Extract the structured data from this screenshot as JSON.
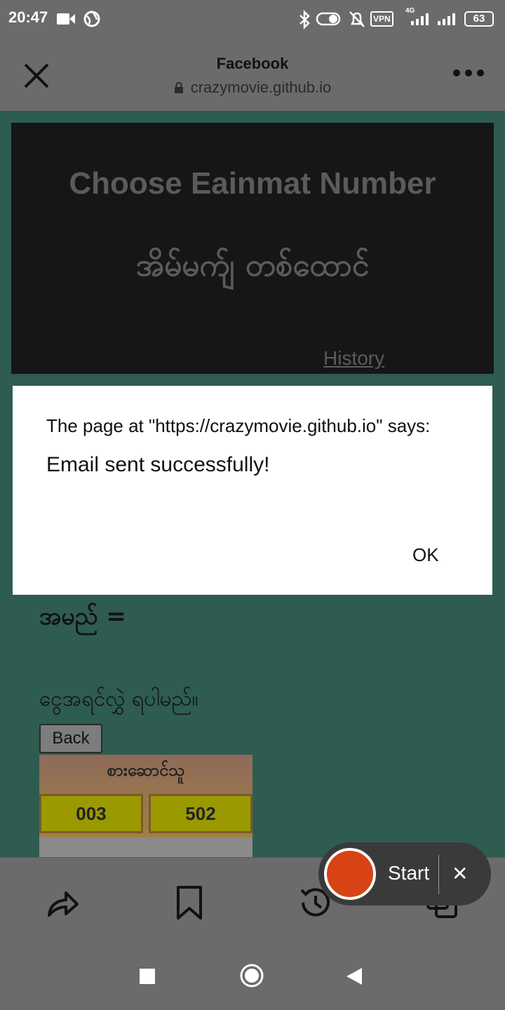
{
  "status_bar": {
    "time": "20:47",
    "vpn": "VPN",
    "network": "4G",
    "battery": "63",
    "icons": [
      "video-icon",
      "globe-icon",
      "bluetooth-icon",
      "toggle-icon",
      "bell-off-icon",
      "vpn-icon",
      "signal-icon",
      "signal-icon",
      "battery-icon"
    ]
  },
  "header": {
    "title": "Facebook",
    "url": "crazymovie.github.io",
    "icons": [
      "close-icon",
      "lock-icon",
      "more-icon"
    ]
  },
  "page": {
    "banner_title": "Choose Eainmat Number",
    "banner_subtitle": "အိမ်မက်ျ တစ်ထောင်",
    "history_link": "History",
    "name_label": "အမည် =",
    "money_label": "ငွေအရင်လွှဲ ရပါမည်။",
    "back_button": "Back",
    "table": {
      "header": "စားဆောင်သူ",
      "cells": [
        "003",
        "502"
      ]
    }
  },
  "dialog": {
    "header": "The page at \"https://crazymovie.github.io\" says:",
    "message": "Email sent successfully!",
    "ok_button": "OK"
  },
  "bottom_bar": {
    "icons": [
      "share-icon",
      "bookmark-icon",
      "history-icon",
      "tabs-icon"
    ]
  },
  "recorder": {
    "start_label": "Start",
    "close_label": "✕",
    "accent_color": "#d84315"
  },
  "nav_bar": {
    "icons": [
      "recents-icon",
      "home-icon",
      "back-icon"
    ]
  }
}
